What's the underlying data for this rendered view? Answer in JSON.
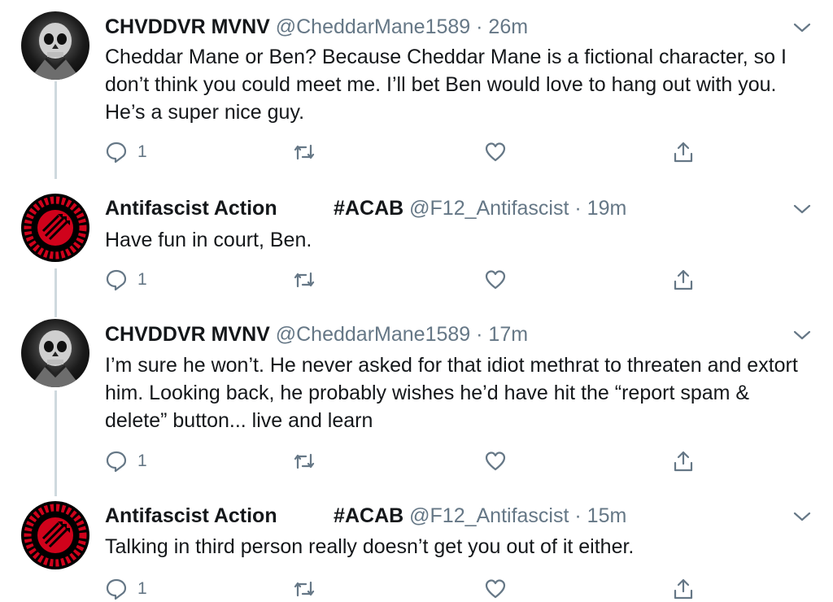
{
  "tweets": [
    {
      "name": "CHVDDVR MVNV",
      "handle": "@CheddarMane1589",
      "separator": "·",
      "time": "26m",
      "text": "Cheddar Mane or Ben? Because Cheddar Mane is a fictional character, so I don’t think you could meet me. I’ll bet Ben would love to hang out with you. He’s a super nice guy.",
      "reply_count": "1",
      "avatar": "skull-avatar"
    },
    {
      "name": "Antifascist Action          #ACAB",
      "handle": "@F12_Antifascist",
      "separator": "·",
      "time": "19m",
      "text": "Have fun in court, Ben.",
      "reply_count": "1",
      "avatar": "antifa-logo-avatar"
    },
    {
      "name": "CHVDDVR MVNV",
      "handle": "@CheddarMane1589",
      "separator": "·",
      "time": "17m",
      "text": "I’m sure he won’t. He never asked for that idiot methrat to threaten and extort him. Looking back, he probably wishes he’d have hit the “report spam & delete” button... live and learn",
      "reply_count": "1",
      "avatar": "skull-avatar"
    },
    {
      "name": "Antifascist Action          #ACAB",
      "handle": "@F12_Antifascist",
      "separator": "·",
      "time": "15m",
      "text": "Talking in third person really doesn’t get you out of it either.",
      "reply_count": "1",
      "avatar": "antifa-logo-avatar"
    }
  ],
  "icons": {
    "reply": "reply-icon",
    "retweet": "retweet-icon",
    "like": "heart-icon",
    "share": "share-icon",
    "more": "chevron-down-icon"
  },
  "colors": {
    "text": "#14171a",
    "muted": "#657786",
    "thread_line": "#cfd9de",
    "antifa_red": "#d0021b"
  }
}
